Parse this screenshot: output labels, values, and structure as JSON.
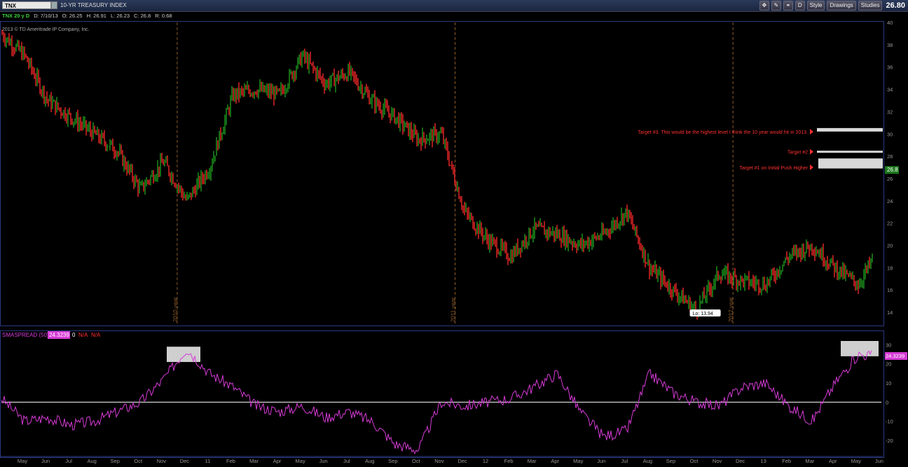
{
  "header": {
    "symbol": "TNX",
    "description": "10-YR TREASURY INDEX",
    "last_price": "26.80",
    "buttons": {
      "d": "D",
      "style": "Style",
      "drawings": "Drawings",
      "studies": "Studies"
    }
  },
  "info_bar": {
    "ticker_label": "TNX 20 y D",
    "date": "D: 7/10/13",
    "open": "O: 26.25",
    "high": "H: 26.91",
    "low": "L: 26.23",
    "close": "C: 26.8",
    "range": "R: 0.68"
  },
  "copyright": "2013 © TD Ameritrade IP Company, Inc.",
  "colors": {
    "up": "#1fa51f",
    "down": "#ff2a2a",
    "study": "#d63bd6",
    "grid": "#8a5a2a",
    "label_red": "#ff3030"
  },
  "chart_data": [
    {
      "type": "line",
      "title": "10-YR TREASURY INDEX",
      "ylim": [
        13,
        40
      ],
      "y_ticks": [
        14,
        16,
        18,
        20,
        22,
        24,
        26,
        28,
        30,
        32,
        34,
        36,
        38,
        40
      ],
      "x_ticks": [
        "May",
        "Jun",
        "Jul",
        "Aug",
        "Sep",
        "Oct",
        "Nov",
        "Dec",
        "11",
        "Feb",
        "Mar",
        "Apr",
        "May",
        "Jun",
        "Jul",
        "Aug",
        "Sep",
        "Oct",
        "Nov",
        "Dec",
        "12",
        "Feb",
        "Mar",
        "Apr",
        "May",
        "Jun",
        "Jul",
        "Aug",
        "Sep",
        "Oct",
        "Nov",
        "Dec",
        "13",
        "Feb",
        "Mar",
        "Apr",
        "May",
        "Jun",
        "Jul"
      ],
      "year_markers": [
        "2010 year",
        "2011 year",
        "2012 year"
      ],
      "last_value_label": "26.8",
      "low_label": "Lo: 13.94",
      "annotations": [
        {
          "text": "Target #3. This would be the highest level I think the 10 year would hit in 2013.",
          "level": 30.2
        },
        {
          "text": "Target #2",
          "level": 28.4
        },
        {
          "text": "Target #1 on Initial Push Higher",
          "level": 27.0
        }
      ],
      "series": [
        {
          "x": [
            0,
            1,
            2,
            3,
            4,
            5,
            6,
            7,
            8,
            9,
            10,
            11,
            12,
            13,
            14,
            15,
            16,
            17,
            18,
            19,
            20,
            21,
            22,
            23,
            24,
            25,
            26,
            27,
            28,
            29,
            30,
            31,
            32,
            33,
            34,
            35,
            36,
            37,
            38
          ],
          "values": [
            39.0,
            37.0,
            33.0,
            31.5,
            30.0,
            28.5,
            25.0,
            27.5,
            24.0,
            27.0,
            33.5,
            34.0,
            33.5,
            37.0,
            34.5,
            35.5,
            33.0,
            31.5,
            29.5,
            30.0,
            23.0,
            20.5,
            19.0,
            21.5,
            21.0,
            20.0,
            21.0,
            23.0,
            18.0,
            16.0,
            14.2,
            17.5,
            16.8,
            16.5,
            19.0,
            20.0,
            18.0,
            16.5,
            20.0
          ]
        }
      ]
    },
    {
      "type": "line",
      "title": "SMASPREAD (50)",
      "last_value_label": "24.3239",
      "extra_labels": [
        "0",
        "N/A",
        "N/A"
      ],
      "ylim": [
        -27,
        32
      ],
      "y_ticks": [
        -20,
        -10,
        0,
        10,
        20,
        30
      ],
      "series": [
        {
          "name": "SMASPREAD (50)",
          "x": [
            0,
            1,
            2,
            3,
            4,
            5,
            6,
            7,
            8,
            9,
            10,
            11,
            12,
            13,
            14,
            15,
            16,
            17,
            18,
            19,
            20,
            21,
            22,
            23,
            24,
            25,
            26,
            27,
            28,
            29,
            30,
            31,
            32,
            33,
            34,
            35,
            36,
            37,
            38
          ],
          "values": [
            2,
            -10,
            -8,
            -12,
            -10,
            -5,
            0,
            12,
            28,
            15,
            8,
            -2,
            -5,
            -2,
            -8,
            -5,
            -10,
            -22,
            -25,
            0,
            -2,
            0,
            2,
            8,
            15,
            -5,
            -18,
            -15,
            15,
            5,
            0,
            -2,
            8,
            10,
            -2,
            -10,
            10,
            25,
            24
          ]
        }
      ]
    }
  ]
}
